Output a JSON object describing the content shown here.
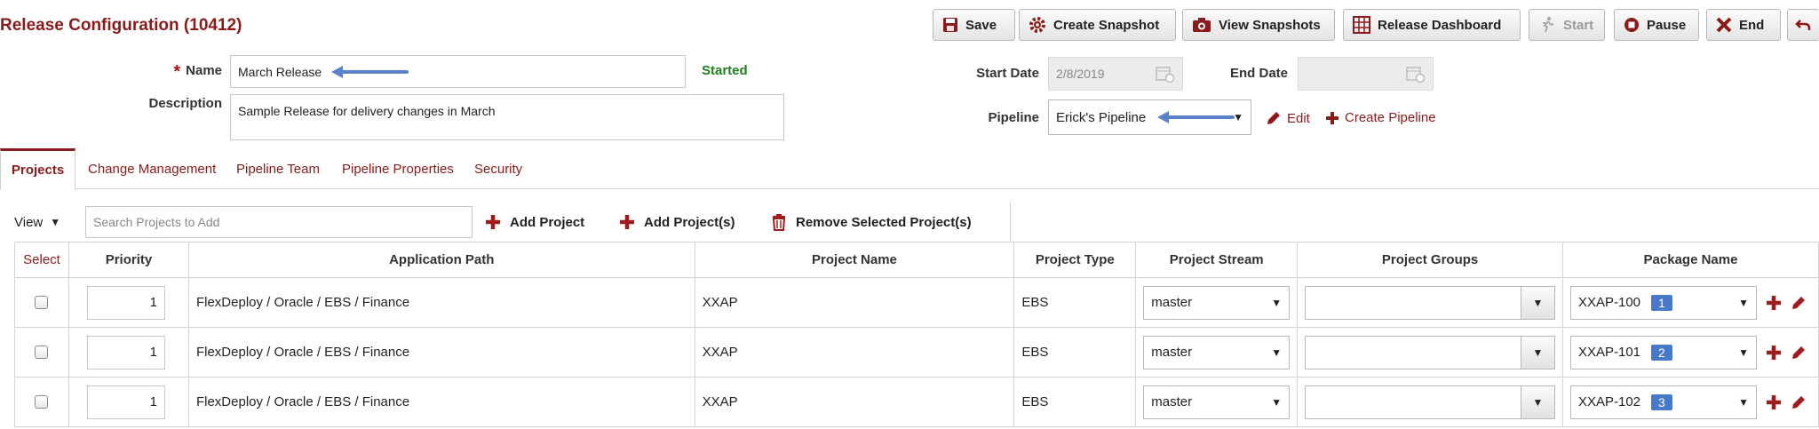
{
  "page": {
    "title": "Release Configuration (10412)"
  },
  "toolbar": {
    "save": "Save",
    "create_snapshot": "Create Snapshot",
    "view_snapshots": "View Snapshots",
    "release_dashboard": "Release Dashboard",
    "start": "Start",
    "pause": "Pause",
    "end": "End"
  },
  "form": {
    "required_mark": "*",
    "name_label": "Name",
    "name_value": "March Release",
    "status": "Started",
    "description_label": "Description",
    "description_value": "Sample Release for delivery changes in March",
    "start_date_label": "Start Date",
    "start_date_value": "2/8/2019",
    "end_date_label": "End Date",
    "end_date_value": "",
    "pipeline_label": "Pipeline",
    "pipeline_value": "Erick's Pipeline",
    "edit_label": "Edit",
    "create_pipeline_label": "Create Pipeline"
  },
  "tabs": [
    "Projects",
    "Change Management",
    "Pipeline Team",
    "Pipeline Properties",
    "Security"
  ],
  "projects_toolbar": {
    "view_label": "View",
    "search_placeholder": "Search Projects to Add",
    "add_project": "Add Project",
    "add_projects": "Add Project(s)",
    "remove_selected": "Remove Selected Project(s)"
  },
  "table": {
    "headers": [
      "Select",
      "Priority",
      "Application Path",
      "Project Name",
      "Project Type",
      "Project Stream",
      "Project Groups",
      "Package Name"
    ],
    "rows": [
      {
        "priority": "1",
        "path": "FlexDeploy / Oracle / EBS / Finance",
        "project": "XXAP",
        "type": "EBS",
        "stream": "master",
        "groups": "",
        "package": "XXAP-100",
        "badge": "1"
      },
      {
        "priority": "1",
        "path": "FlexDeploy / Oracle / EBS / Finance",
        "project": "XXAP",
        "type": "EBS",
        "stream": "master",
        "groups": "",
        "package": "XXAP-101",
        "badge": "2"
      },
      {
        "priority": "1",
        "path": "FlexDeploy / Oracle / EBS / Finance",
        "project": "XXAP",
        "type": "EBS",
        "stream": "master",
        "groups": "",
        "package": "XXAP-102",
        "badge": "3"
      }
    ]
  },
  "colors": {
    "brand": "#8b1a1a",
    "status_green": "#208020",
    "badge_blue": "#4a78c9",
    "arrow_blue": "#5b82c9"
  }
}
